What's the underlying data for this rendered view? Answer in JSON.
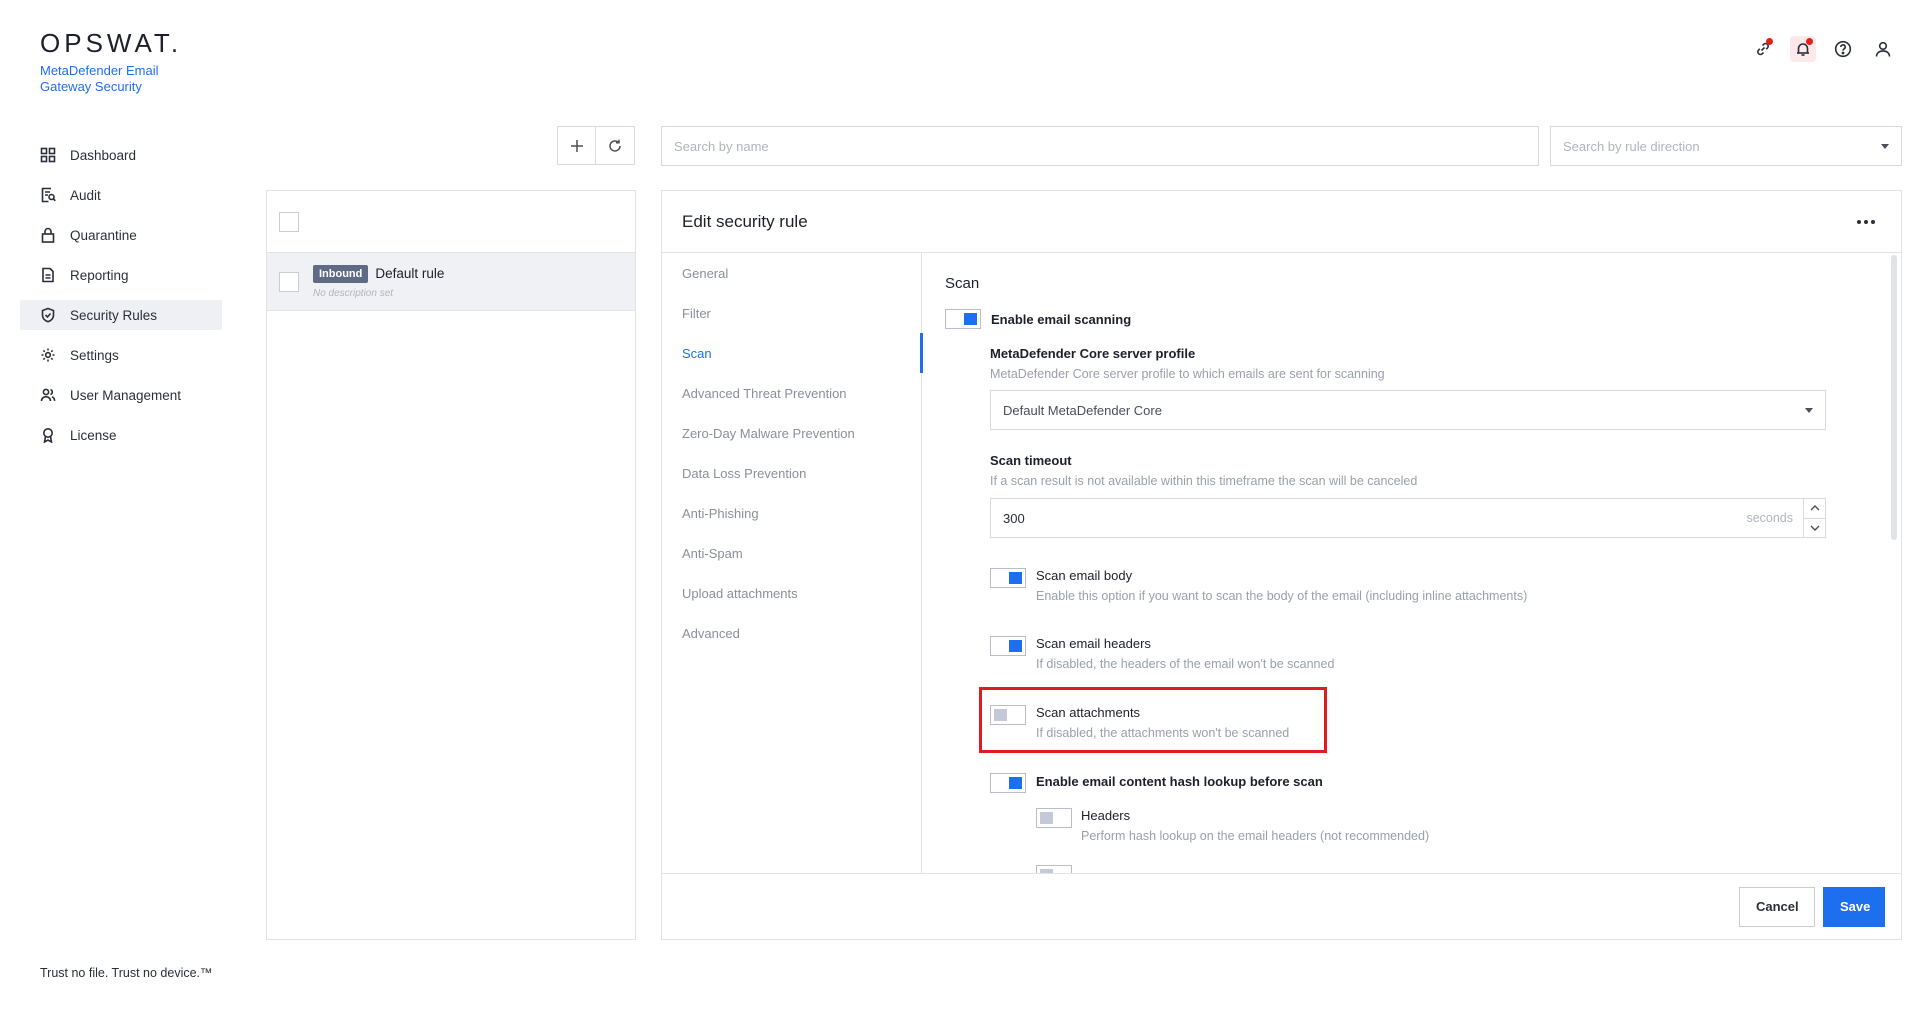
{
  "brand": {
    "logo": "OPSWAT.",
    "product": "MetaDefender Email Gateway Security"
  },
  "sidebar": {
    "items": [
      {
        "label": "Dashboard",
        "icon": "grid-icon"
      },
      {
        "label": "Audit",
        "icon": "audit-icon"
      },
      {
        "label": "Quarantine",
        "icon": "lock-icon"
      },
      {
        "label": "Reporting",
        "icon": "document-icon"
      },
      {
        "label": "Security Rules",
        "icon": "shield-check-icon",
        "active": true
      },
      {
        "label": "Settings",
        "icon": "gear-icon"
      },
      {
        "label": "User Management",
        "icon": "users-icon"
      },
      {
        "label": "License",
        "icon": "license-icon"
      }
    ]
  },
  "tagline": "Trust no file. Trust no device.™",
  "header": {
    "icons": [
      "link-icon",
      "bell-icon",
      "help-icon",
      "user-icon"
    ],
    "notification_color": "#e0201a"
  },
  "search": {
    "name_placeholder": "Search by name",
    "direction_placeholder": "Search by rule direction"
  },
  "rules": [
    {
      "badge": "Inbound",
      "name": "Default rule",
      "description": "No description set"
    }
  ],
  "edit": {
    "title": "Edit security rule",
    "tabs": [
      "General",
      "Filter",
      "Scan",
      "Advanced Threat Prevention",
      "Zero-Day Malware Prevention",
      "Data Loss Prevention",
      "Anti-Phishing",
      "Anti-Spam",
      "Upload attachments",
      "Advanced"
    ],
    "active_tab": "Scan",
    "section_title": "Scan",
    "enable_scanning": {
      "label": "Enable email scanning",
      "on": true
    },
    "server_profile": {
      "label": "MetaDefender Core server profile",
      "description": "MetaDefender Core server profile to which emails are sent for scanning",
      "value": "Default MetaDefender Core"
    },
    "timeout": {
      "label": "Scan timeout",
      "description": "If a scan result is not available within this timeframe the scan will be canceled",
      "value": "300",
      "unit": "seconds"
    },
    "scan_body": {
      "label": "Scan email body",
      "description": "Enable this option if you want to scan the body of the email (including inline attachments)",
      "on": true
    },
    "scan_headers": {
      "label": "Scan email headers",
      "description": "If disabled, the headers of the email won't be scanned",
      "on": true
    },
    "scan_attachments": {
      "label": "Scan attachments",
      "description": "If disabled, the attachments won't be scanned",
      "on": false
    },
    "hash_lookup": {
      "label": "Enable email content hash lookup before scan",
      "on": true
    },
    "hash_headers": {
      "label": "Headers",
      "description": "Perform hash lookup on the email headers (not recommended)",
      "on": false
    },
    "cancel_label": "Cancel",
    "save_label": "Save"
  },
  "colors": {
    "accent": "#1d6ff0",
    "highlight": "#e01b22"
  }
}
